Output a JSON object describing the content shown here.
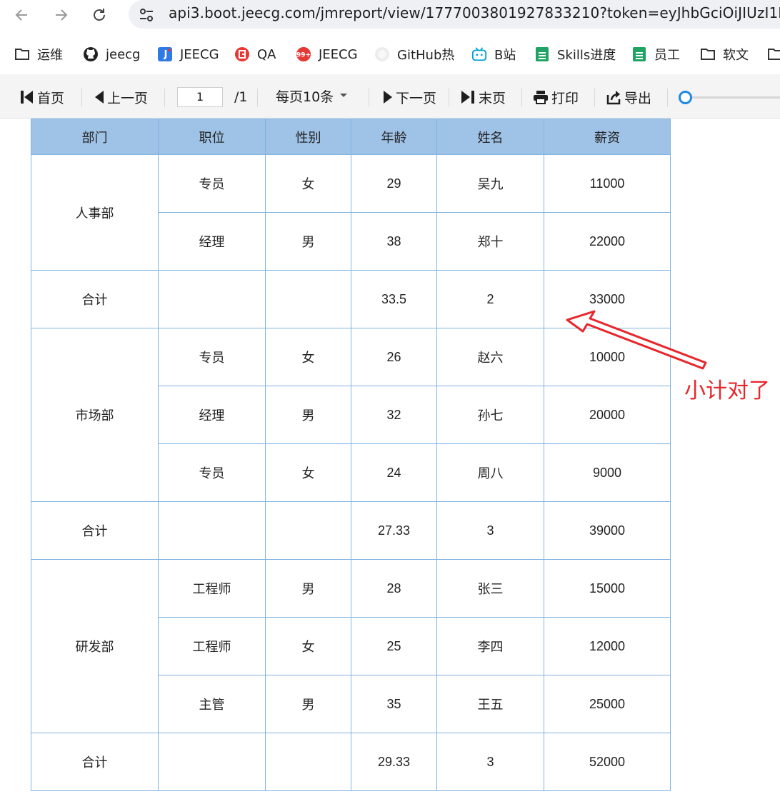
{
  "browser": {
    "url": "api3.boot.jeecg.com/jmreport/view/1777003801927833210?token=eyJhbGciOiJIUzI1N",
    "bookmarks": [
      {
        "label": "运维",
        "icon": "folder-icon"
      },
      {
        "label": "jeecg",
        "icon": "github-icon"
      },
      {
        "label": "JEECG",
        "icon": "jeecg-icon"
      },
      {
        "label": "QA",
        "icon": "qa-icon"
      },
      {
        "label": "JEECG",
        "icon": "badge-99-icon"
      },
      {
        "label": "GitHub热",
        "icon": "github-icon"
      },
      {
        "label": "B站",
        "icon": "bilibili-icon"
      },
      {
        "label": "Skills进度",
        "icon": "sheet-icon"
      },
      {
        "label": "员工",
        "icon": "sheet-icon"
      },
      {
        "label": "软文",
        "icon": "folder-icon"
      }
    ]
  },
  "toolbar": {
    "first": "首页",
    "prev": "上一页",
    "page_value": "1",
    "page_total": "/1",
    "page_size": "每页10条",
    "next": "下一页",
    "last": "末页",
    "print": "打印",
    "export": "导出"
  },
  "report": {
    "headers": [
      "部门",
      "职位",
      "性别",
      "年龄",
      "姓名",
      "薪资"
    ],
    "groups": [
      {
        "dept": "人事部",
        "rows": [
          {
            "position": "专员",
            "gender": "女",
            "age": "29",
            "name": "吴九",
            "salary": "11000"
          },
          {
            "position": "经理",
            "gender": "男",
            "age": "38",
            "name": "郑十",
            "salary": "22000"
          }
        ],
        "subtotal": {
          "label": "合计",
          "age": "33.5",
          "count": "2",
          "salary": "33000"
        }
      },
      {
        "dept": "市场部",
        "rows": [
          {
            "position": "专员",
            "gender": "女",
            "age": "26",
            "name": "赵六",
            "salary": "10000"
          },
          {
            "position": "经理",
            "gender": "男",
            "age": "32",
            "name": "孙七",
            "salary": "20000"
          },
          {
            "position": "专员",
            "gender": "女",
            "age": "24",
            "name": "周八",
            "salary": "9000"
          }
        ],
        "subtotal": {
          "label": "合计",
          "age": "27.33",
          "count": "3",
          "salary": "39000"
        }
      },
      {
        "dept": "研发部",
        "rows": [
          {
            "position": "工程师",
            "gender": "男",
            "age": "28",
            "name": "张三",
            "salary": "15000"
          },
          {
            "position": "工程师",
            "gender": "女",
            "age": "25",
            "name": "李四",
            "salary": "12000"
          },
          {
            "position": "主管",
            "gender": "男",
            "age": "35",
            "name": "王五",
            "salary": "25000"
          }
        ],
        "subtotal": {
          "label": "合计",
          "age": "29.33",
          "count": "3",
          "salary": "52000"
        }
      }
    ]
  },
  "annotation": {
    "text": "小计对了",
    "color": "#e8262b"
  },
  "colors": {
    "header_bg": "#9fc3e7",
    "border": "#7fb3e0",
    "accent": "#1e88e5"
  }
}
